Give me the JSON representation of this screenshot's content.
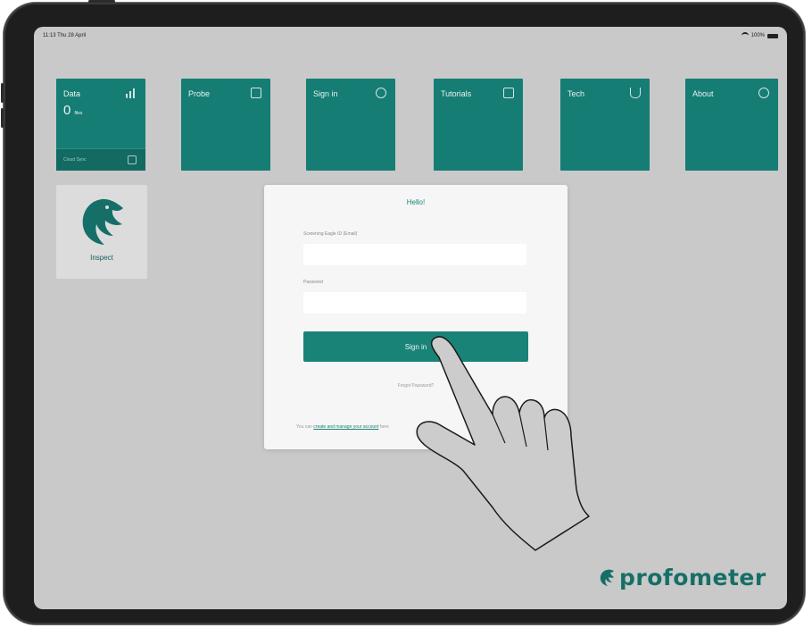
{
  "status_bar": {
    "time": "11:13 Thu 28 April",
    "battery": "100%"
  },
  "tiles": [
    {
      "label": "Data",
      "icon": "bar-chart-icon"
    },
    {
      "label": "Probe",
      "icon": "probe-icon"
    },
    {
      "label": "Sign in",
      "icon": "user-circle-icon"
    },
    {
      "label": "Tutorials",
      "icon": "play-copy-icon"
    },
    {
      "label": "Tech",
      "icon": "cup-icon"
    },
    {
      "label": "About",
      "icon": "info-icon"
    }
  ],
  "data_tile": {
    "count": "0",
    "unit": "files",
    "strip_label": "Cloud Sync"
  },
  "inspect": {
    "label": "Inspect",
    "icon": "eagle-logo-icon"
  },
  "dialog": {
    "title": "Hello!",
    "email_label": "Screening Eagle ID (Email)",
    "email_value": "",
    "password_label": "Password",
    "password_value": "",
    "signin_label": "Sign in",
    "forgot_label": "Forgot Password?",
    "create_prefix": "You can",
    "create_link": "create and manage your account",
    "create_suffix": "here"
  },
  "brand": {
    "name": "profometer",
    "color": "#156f68"
  },
  "colors": {
    "tile": "#167d74",
    "accent": "#1a8378",
    "screen_background": "#c9c9c9"
  }
}
